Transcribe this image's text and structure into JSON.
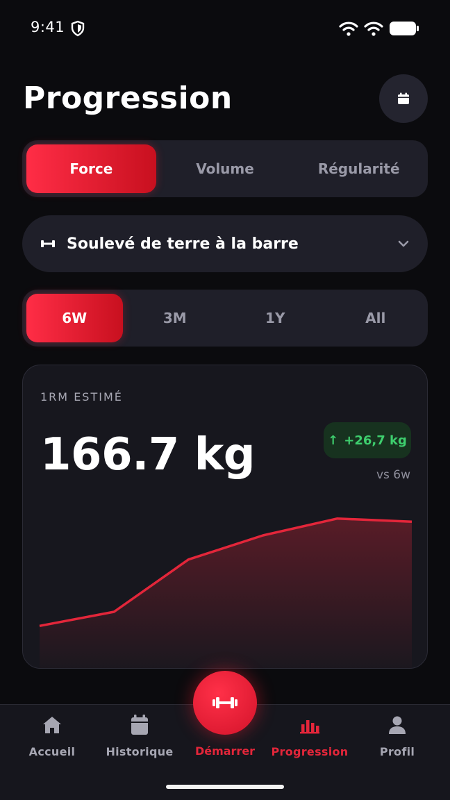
{
  "status_bar": {
    "time": "9:41"
  },
  "header": {
    "title": "Progression"
  },
  "metric_tabs": [
    {
      "label": "Force",
      "active": true
    },
    {
      "label": "Volume",
      "active": false
    },
    {
      "label": "Régularité",
      "active": false
    }
  ],
  "exercise": {
    "icon": "dumbbell-icon",
    "label": "Soulevé de terre à la barre"
  },
  "period_tabs": [
    {
      "label": "6W",
      "active": true
    },
    {
      "label": "3M",
      "active": false
    },
    {
      "label": "1Y",
      "active": false
    },
    {
      "label": "All",
      "active": false
    }
  ],
  "card": {
    "label": "1RM ESTIMÉ",
    "value": "166.7 kg",
    "delta_arrow": "↑",
    "delta": "+26,7 kg",
    "delta_sub": "vs 6w"
  },
  "chart_data": {
    "type": "area",
    "x": [
      1,
      2,
      3,
      4,
      5,
      6
    ],
    "values": [
      140.0,
      143.5,
      156.5,
      162.5,
      166.7,
      165.9
    ],
    "ylim": [
      134,
      172
    ],
    "color": "#e3263a",
    "grid": false
  },
  "tabbar": {
    "items": [
      {
        "label": "Accueil",
        "icon": "home-icon",
        "active": false
      },
      {
        "label": "Historique",
        "icon": "calendar-icon",
        "active": false
      },
      {
        "label": "Progression",
        "icon": "bar-chart-icon",
        "active": true
      },
      {
        "label": "Profil",
        "icon": "user-icon",
        "active": false
      }
    ],
    "fab": {
      "label": "Démarrer",
      "icon": "dumbbell-icon"
    }
  },
  "colors": {
    "accent": "#e3263a",
    "positive": "#3ecf6e",
    "background": "#0b0b0e",
    "surface": "#1f1f29"
  }
}
